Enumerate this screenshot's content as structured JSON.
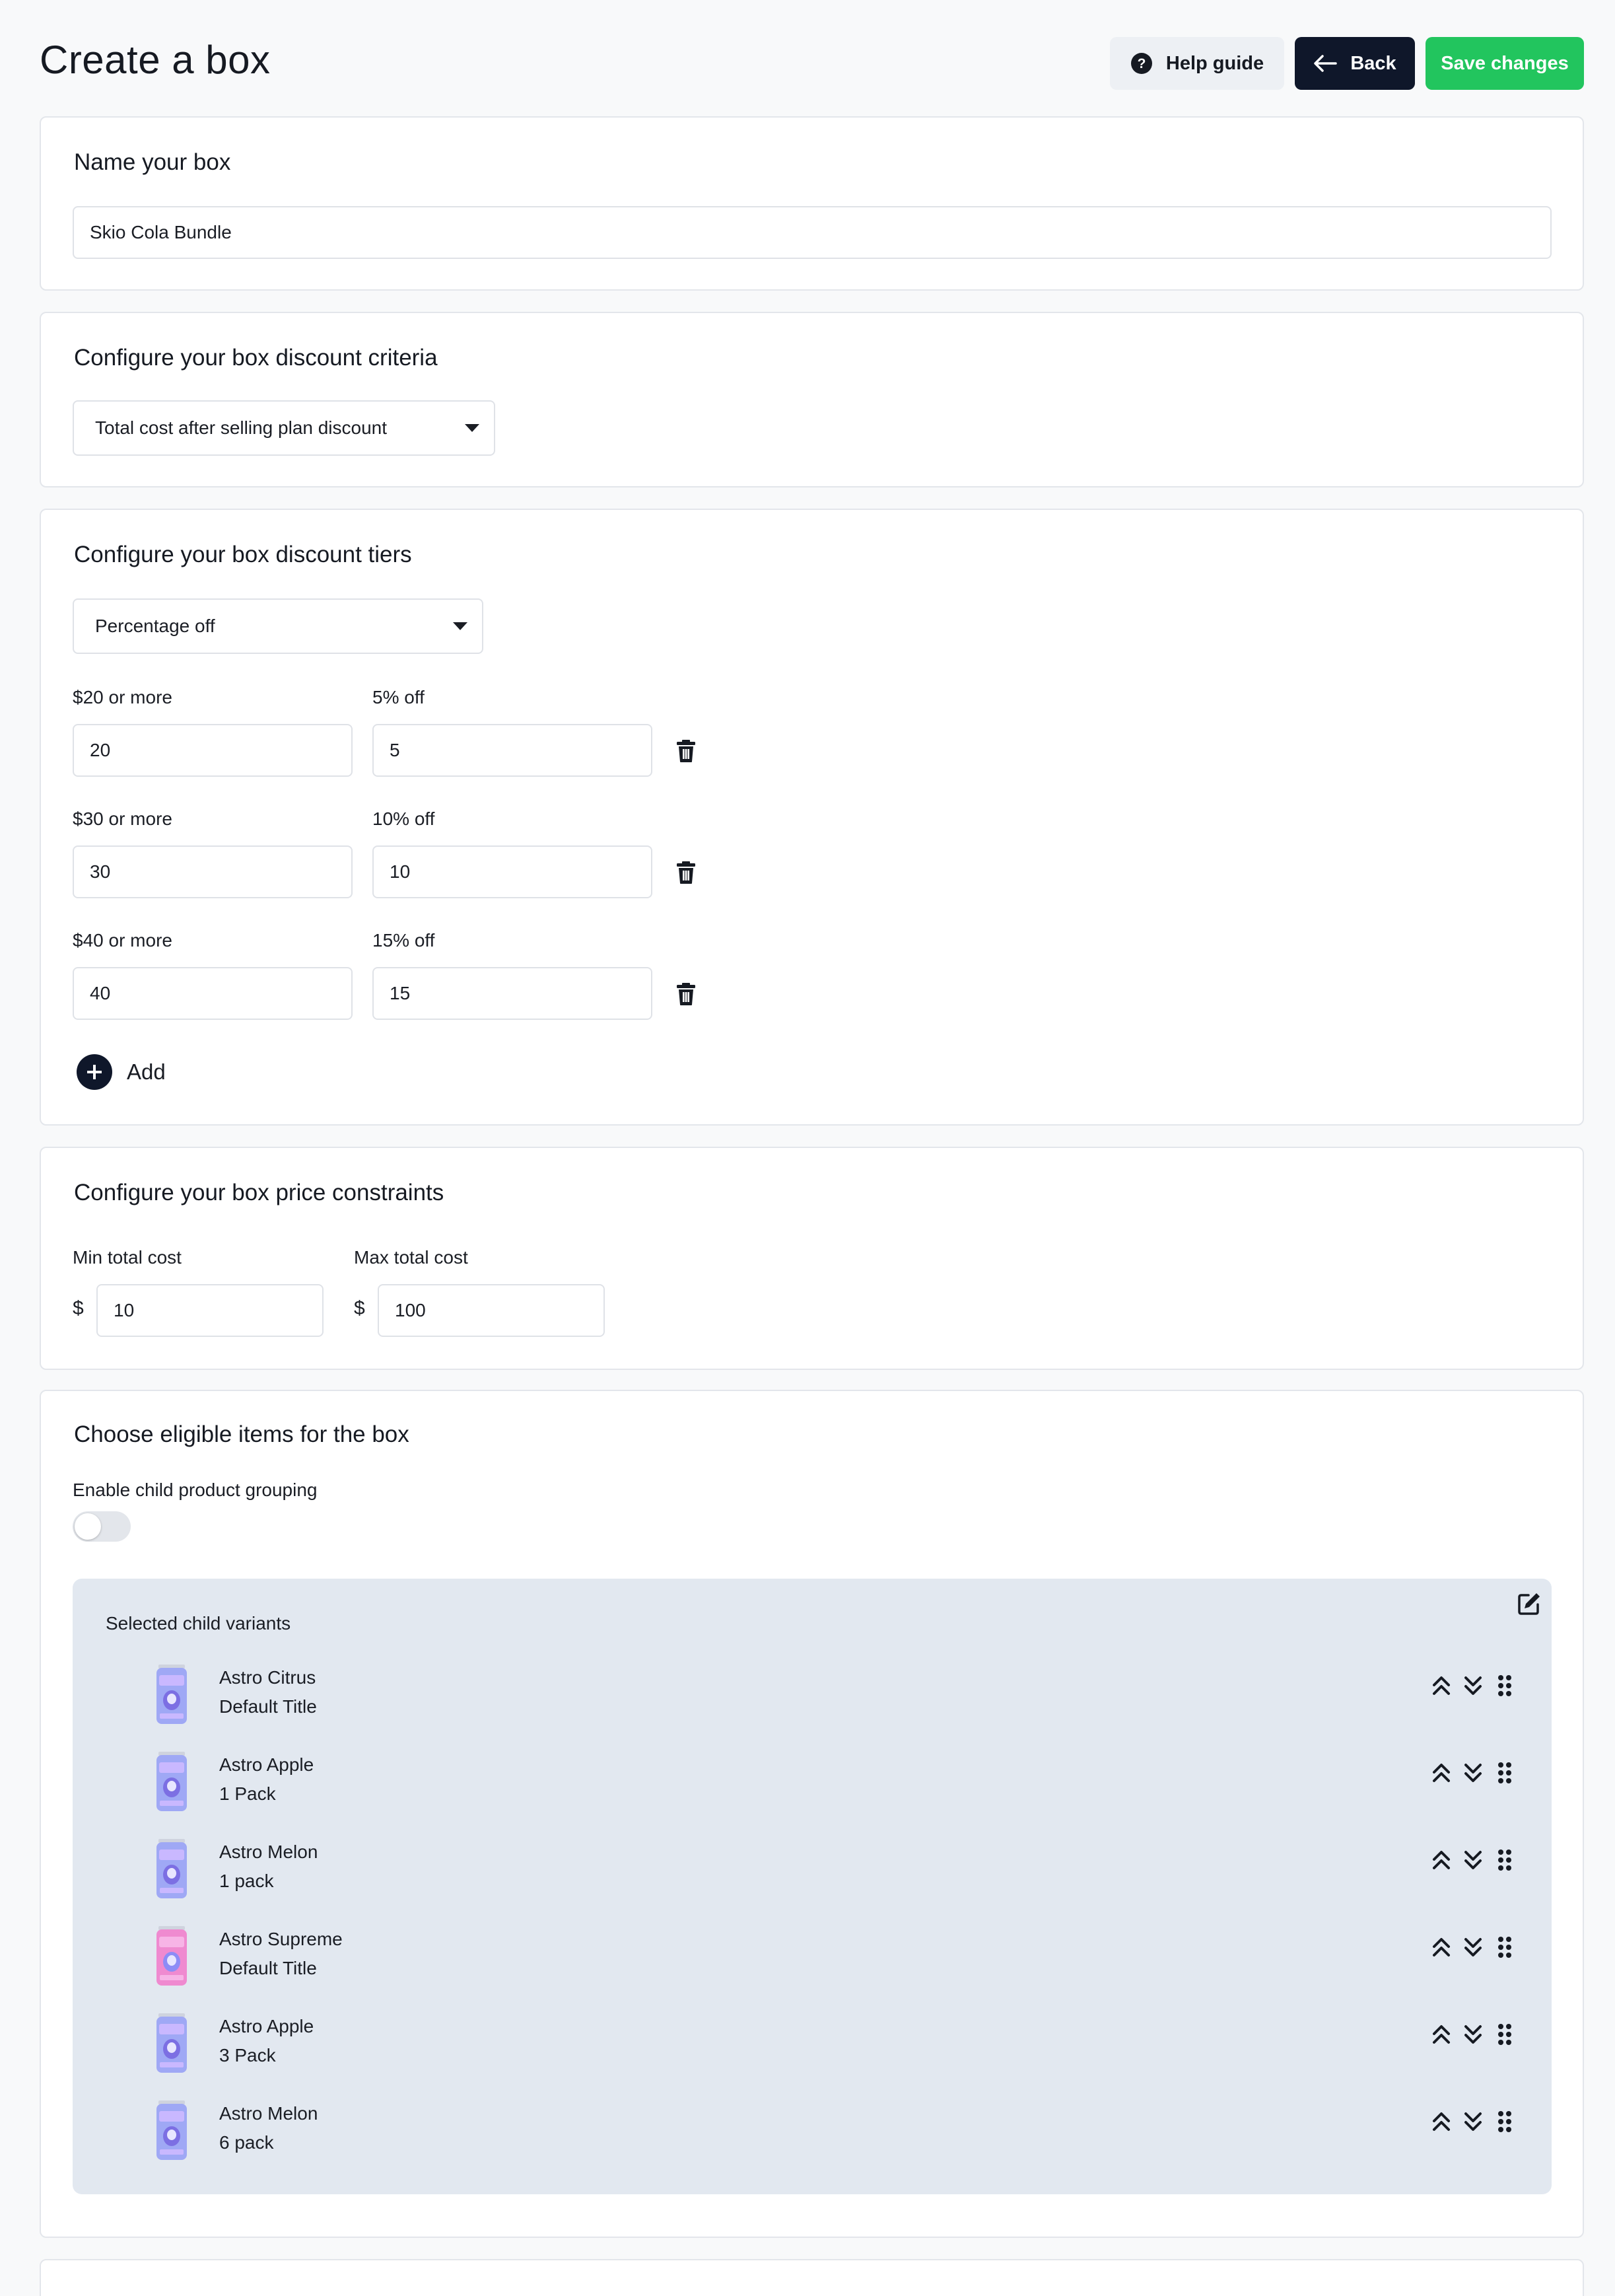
{
  "header": {
    "title": "Create a box",
    "help_label": "Help guide",
    "back_label": "Back",
    "save_label": "Save changes"
  },
  "name_section": {
    "title": "Name your box",
    "value": "Skio Cola Bundle"
  },
  "criteria_section": {
    "title": "Configure your box discount criteria",
    "selected": "Total cost after selling plan discount"
  },
  "tiers_section": {
    "title": "Configure your box discount tiers",
    "type_selected": "Percentage off",
    "tiers": [
      {
        "threshold_label": "$20 or more",
        "threshold": "20",
        "discount_label": "5% off",
        "discount": "5"
      },
      {
        "threshold_label": "$30 or more",
        "threshold": "30",
        "discount_label": "10% off",
        "discount": "10"
      },
      {
        "threshold_label": "$40 or more",
        "threshold": "40",
        "discount_label": "15% off",
        "discount": "15"
      }
    ],
    "add_label": "Add"
  },
  "price_section": {
    "title": "Configure your box price constraints",
    "min_label": "Min total cost",
    "min_currency": "$",
    "min_value": "10",
    "max_label": "Max total cost",
    "max_currency": "$",
    "max_value": "100"
  },
  "items_section": {
    "title": "Choose eligible items for the box",
    "grouping_label": "Enable child product grouping",
    "grouping_enabled": false,
    "variants_heading": "Selected child variants",
    "variants": [
      {
        "name": "Astro Citrus",
        "variant": "Default Title",
        "thumb": "purple-can"
      },
      {
        "name": "Astro Apple",
        "variant": "1 Pack",
        "thumb": "purple-can"
      },
      {
        "name": "Astro Melon",
        "variant": "1 pack",
        "thumb": "purple-can"
      },
      {
        "name": "Astro Supreme",
        "variant": "Default Title",
        "thumb": "pink-can"
      },
      {
        "name": "Astro Apple",
        "variant": "3 Pack",
        "thumb": "purple-can"
      },
      {
        "name": "Astro Melon",
        "variant": "6 pack",
        "thumb": "purple-can"
      }
    ]
  },
  "colors": {
    "primary_dark": "#0f172a",
    "save_green": "#22c55e",
    "panel_gray": "#e2e8f0"
  }
}
